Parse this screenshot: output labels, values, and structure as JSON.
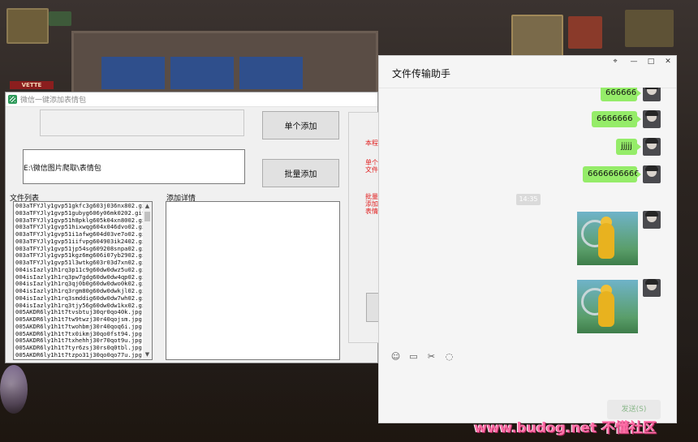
{
  "desktop": {
    "corvette_text": "VETTE"
  },
  "app": {
    "title": "微信一键添加表情包",
    "folder_path": "E:\\微信图片爬取\\表情包",
    "btn_single": "单个添加",
    "btn_batch": "批量添加",
    "file_list_label": "文件列表",
    "detail_label": "添加详情",
    "notes": [
      "本程",
      "单个",
      "文件",
      "批量",
      "添加",
      "表情"
    ],
    "files": [
      "003aTFYJly1gvp51gkfc3g603j036nx802.gif",
      "003aTFYJly1gvp51gubyg606y06mk0202.gif",
      "003aTFYJly1gvp51h8pklg605k04xn8002.gif",
      "003aTFYJly1gvp51hixwqg604x046dvo02.gif",
      "003aTFYJly1gvp51i1afwg604d03ve7o02.gif",
      "003aTFYJly1gvp51iifvpg604903ik2402.gif",
      "003aTFYJly1gvp51jp54sg609208snpa02.gif",
      "003aTFYJly1gvp51kgz6mg606i07yb2902.gif",
      "003aTFYJly1gvp51l3wtkg603r03d7xn02.gif",
      "004isIazly1h1rq3p11c9g60dw0dwz5u02.gif",
      "004isIazly1h1rq3pw7gdg60dw0dw4qp02.gif",
      "004isIazly1h1rq3qj0b0g60dw0dwo0k02.gif",
      "004isIazly1h1rq3rgm80g60dw0dwkjl02.gif",
      "004isIazly1h1rq3smddig60dw0dw7wh02.gif",
      "004isIazly1h1rq3tjy56g60dw0dw1kx02.gif",
      "005AKDR6ly1h1t7tvsbtuj30qr0qo40k.jpg",
      "005AKDR6ly1h1t7tw9twzj30r40qojsm.jpg",
      "005AKDR6ly1h1t7twohbmj30r40qoq6i.jpg",
      "005AKDR6ly1h1t7tx0ikmj30qo0fst94.jpg",
      "005AKDR6ly1h1t7txhehhj30r70qot9u.jpg",
      "005AKDR6ly1h1t7tyr6zsj30rs0q0tbl.jpg",
      "005AKDR6ly1h1t7tzpo31j30qo0qo77u.jpg"
    ]
  },
  "chat": {
    "title": "文件传输助手",
    "window_controls": [
      "⌖",
      "—",
      "□",
      "✕"
    ],
    "messages": [
      "666666",
      "6666666",
      "jjjjj",
      "6666666666"
    ],
    "timestamp": "14:35",
    "tools": [
      "☺",
      "▭",
      "✂",
      "◌"
    ],
    "send_label": "发送(S)"
  },
  "watermark": "www.budog.net 不懂社区"
}
